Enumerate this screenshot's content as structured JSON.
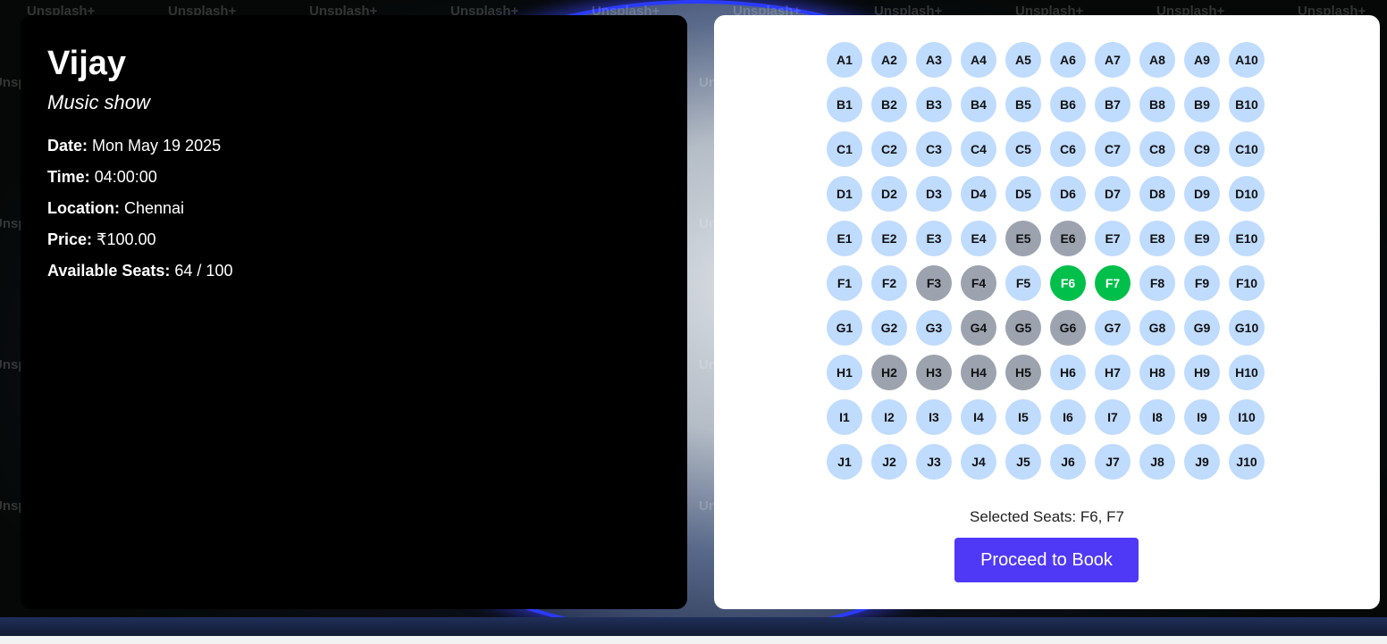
{
  "watermark": "Unsplash+",
  "event": {
    "title": "Vijay",
    "subtitle": "Music show",
    "details": [
      {
        "label": "Date:",
        "value": "Mon May 19 2025"
      },
      {
        "label": "Time:",
        "value": "04:00:00"
      },
      {
        "label": "Location:",
        "value": "Chennai"
      },
      {
        "label": "Price:",
        "value": "₹100.00"
      },
      {
        "label": "Available Seats:",
        "value": "64 / 100"
      }
    ]
  },
  "seating": {
    "rows": [
      "A",
      "B",
      "C",
      "D",
      "E",
      "F",
      "G",
      "H",
      "I",
      "J"
    ],
    "seats_per_row": 10,
    "booked": [
      "E5",
      "E6",
      "F3",
      "F4",
      "G4",
      "G5",
      "G6",
      "H2",
      "H3",
      "H4",
      "H5"
    ],
    "selected": [
      "F6",
      "F7"
    ],
    "selected_text": "Selected Seats: F6, F7",
    "book_label": "Proceed to Book"
  },
  "colors": {
    "available": "#bfdbfe",
    "booked": "#9ca3af",
    "selected": "#00c04b",
    "accent": "#4f39f6"
  }
}
